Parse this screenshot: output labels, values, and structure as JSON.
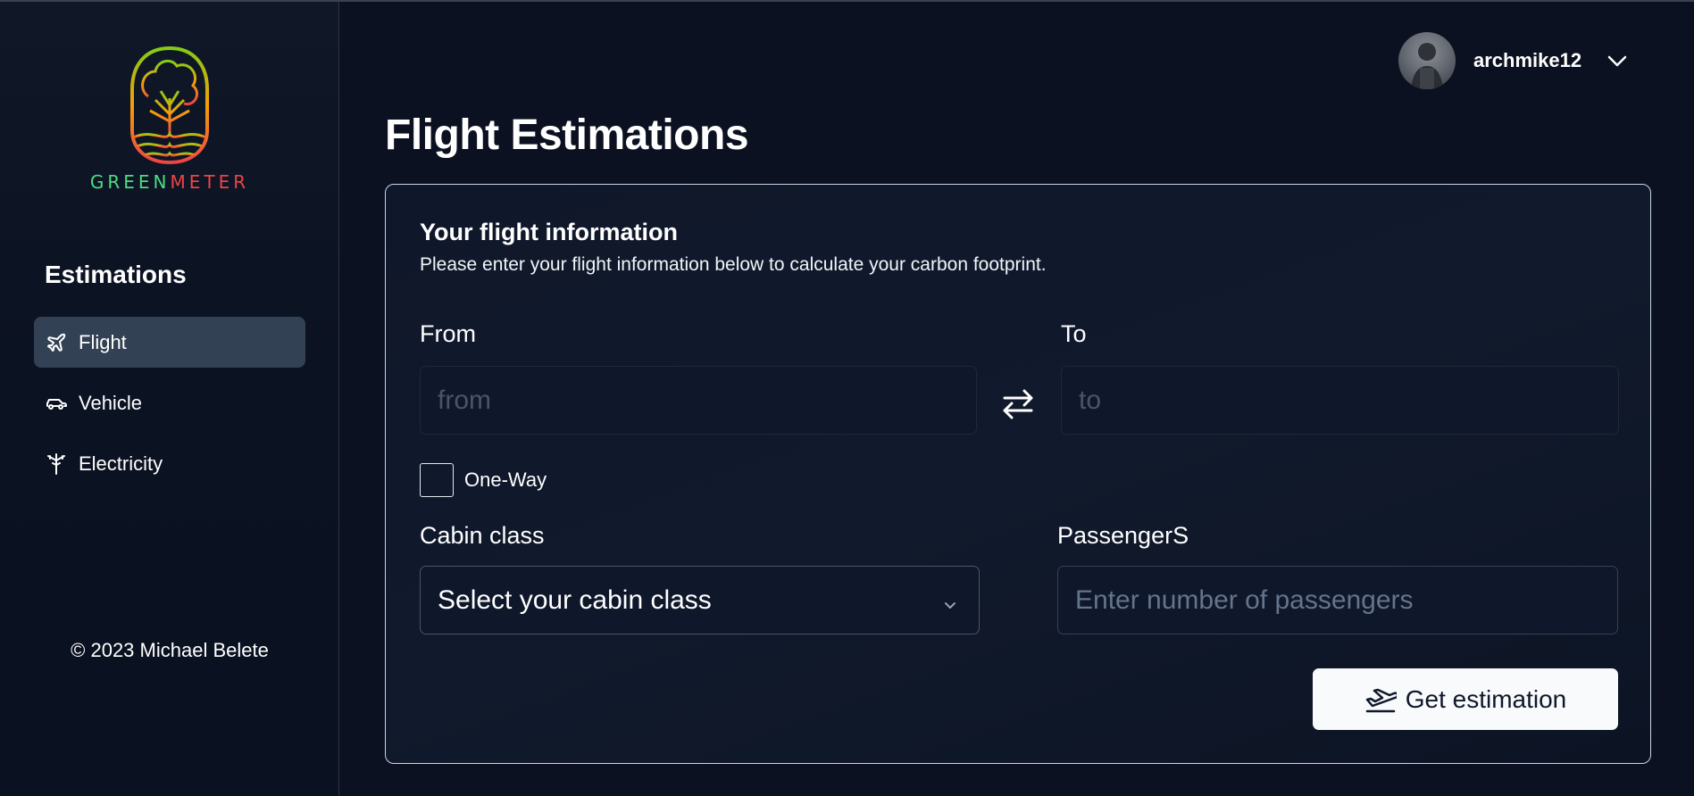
{
  "brand": {
    "logo_text_green": "GREEN",
    "logo_text_red": "METER",
    "green_color": "#4ade80",
    "red_color": "#ef4444"
  },
  "sidebar": {
    "heading": "Estimations",
    "items": [
      {
        "label": "Flight",
        "icon": "plane-icon",
        "active": true
      },
      {
        "label": "Vehicle",
        "icon": "car-icon",
        "active": false
      },
      {
        "label": "Electricity",
        "icon": "power-tower-icon",
        "active": false
      }
    ],
    "copyright": "© 2023 Michael Belete"
  },
  "header": {
    "username": "archmike12"
  },
  "page": {
    "title": "Flight Estimations"
  },
  "form": {
    "title": "Your flight information",
    "subtitle": "Please enter your flight information below to calculate your carbon footprint.",
    "from_label": "From",
    "from_placeholder": "from",
    "to_label": "To",
    "to_placeholder": "to",
    "one_way_label": "One-Way",
    "cabin_label": "Cabin class",
    "cabin_value": "Select your cabin class",
    "passengers_label": "PassengerS",
    "passengers_placeholder": "Enter number of passengers",
    "submit_label": "Get estimation"
  }
}
